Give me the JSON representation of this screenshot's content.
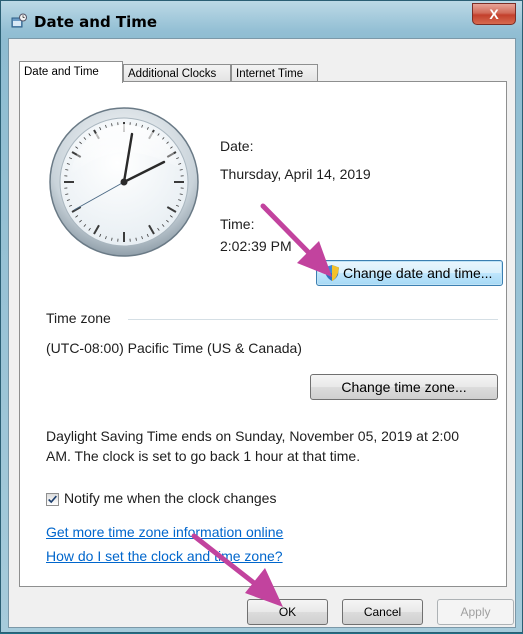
{
  "window": {
    "title": "Date and Time",
    "close_glyph": "X"
  },
  "tabs": [
    {
      "label": "Date and Time",
      "active": true
    },
    {
      "label": "Additional Clocks",
      "active": false
    },
    {
      "label": "Internet Time",
      "active": false
    }
  ],
  "datetime": {
    "date_label": "Date:",
    "date_value": "Thursday, April 14, 2019",
    "time_label": "Time:",
    "time_value": "2:02:39 PM",
    "change_button": "Change date and time..."
  },
  "timezone": {
    "group_label": "Time zone",
    "value": "(UTC-08:00) Pacific Time (US & Canada)",
    "change_button": "Change time zone..."
  },
  "dst": {
    "line1": "Daylight Saving Time ends on Sunday, November 05, 2019 at 2:00",
    "line2": "AM. The clock is set to go back 1 hour at that time."
  },
  "notify": {
    "label": "Notify me when the clock changes",
    "checked": true
  },
  "links": {
    "more_info": "Get more time zone information online",
    "how_to": "How do I set the clock and time zone?"
  },
  "footer": {
    "ok": "OK",
    "cancel": "Cancel",
    "apply": "Apply"
  },
  "colors": {
    "annotation_arrow": "#c2439e",
    "link": "#0066cc"
  },
  "icons": {
    "title": "clock-settings-icon",
    "uac": "uac-shield-icon"
  }
}
